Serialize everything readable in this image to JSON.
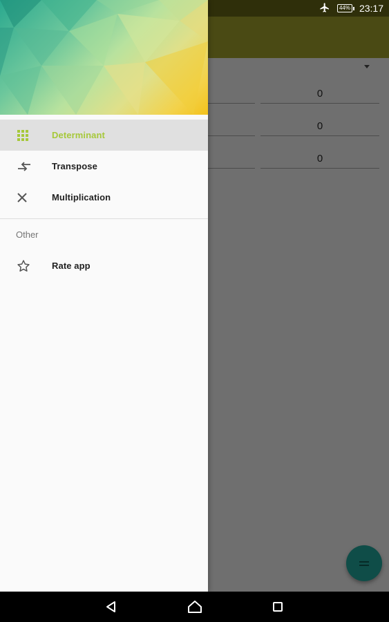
{
  "status_bar": {
    "battery": "44%",
    "time": "23:17",
    "icons": [
      "airplane-mode-icon",
      "battery-icon"
    ]
  },
  "matrix": {
    "visible_cells": [
      "0",
      "0",
      "0"
    ]
  },
  "drawer": {
    "items": [
      {
        "label": "Determinant",
        "icon": "grid-icon",
        "active": true
      },
      {
        "label": "Transpose",
        "icon": "swap-arrows-icon",
        "active": false
      },
      {
        "label": "Multiplication",
        "icon": "multiply-icon",
        "active": false
      }
    ],
    "section_other": "Other",
    "other_items": [
      {
        "label": "Rate app",
        "icon": "star-outline-icon"
      }
    ]
  },
  "fab": {
    "icon": "equals-icon"
  },
  "nav_bar": {
    "buttons": [
      "back-icon",
      "home-icon",
      "recents-icon"
    ]
  },
  "colors": {
    "accent_active": "#a6c83a",
    "toolbar": "#4a4a14",
    "fab": "#0f4d48",
    "drawer_bg": "#fafafa"
  }
}
